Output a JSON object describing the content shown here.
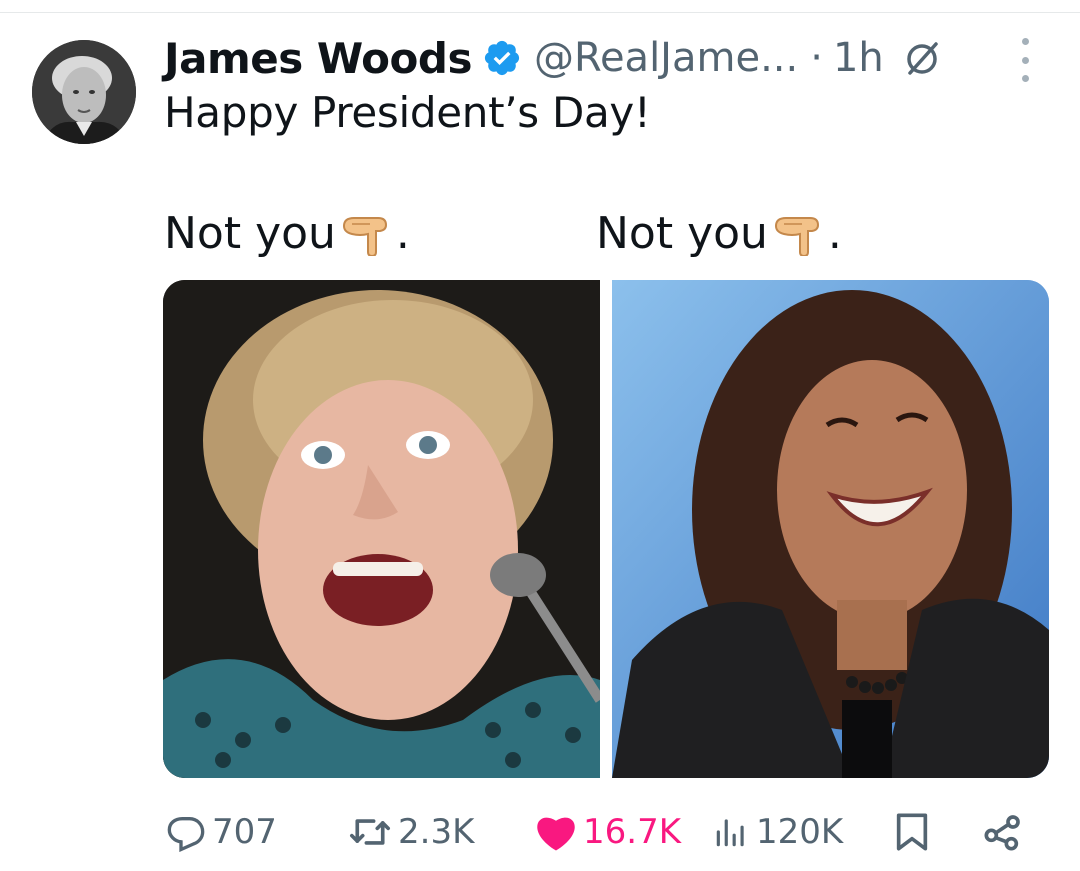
{
  "tweet": {
    "author_name": "James Woods",
    "handle": "@RealJame...",
    "separator": "·",
    "time": "1h",
    "text": "Happy President’s Day!",
    "captions": [
      {
        "text": "Not you",
        "suffix": "."
      },
      {
        "text": "Not you",
        "suffix": "."
      }
    ]
  },
  "actions": {
    "replies": "707",
    "reposts": "2.3K",
    "likes": "16.7K",
    "views": "120K"
  },
  "colors": {
    "verified": "#1d9bf0",
    "like": "#f91880",
    "secondary_text": "#536471"
  },
  "icons": [
    "verified-badge-icon",
    "grok-icon",
    "more-icon",
    "reply-icon",
    "repost-icon",
    "like-icon",
    "views-icon",
    "bookmark-icon",
    "share-icon",
    "pointing-down-hand-icon"
  ]
}
